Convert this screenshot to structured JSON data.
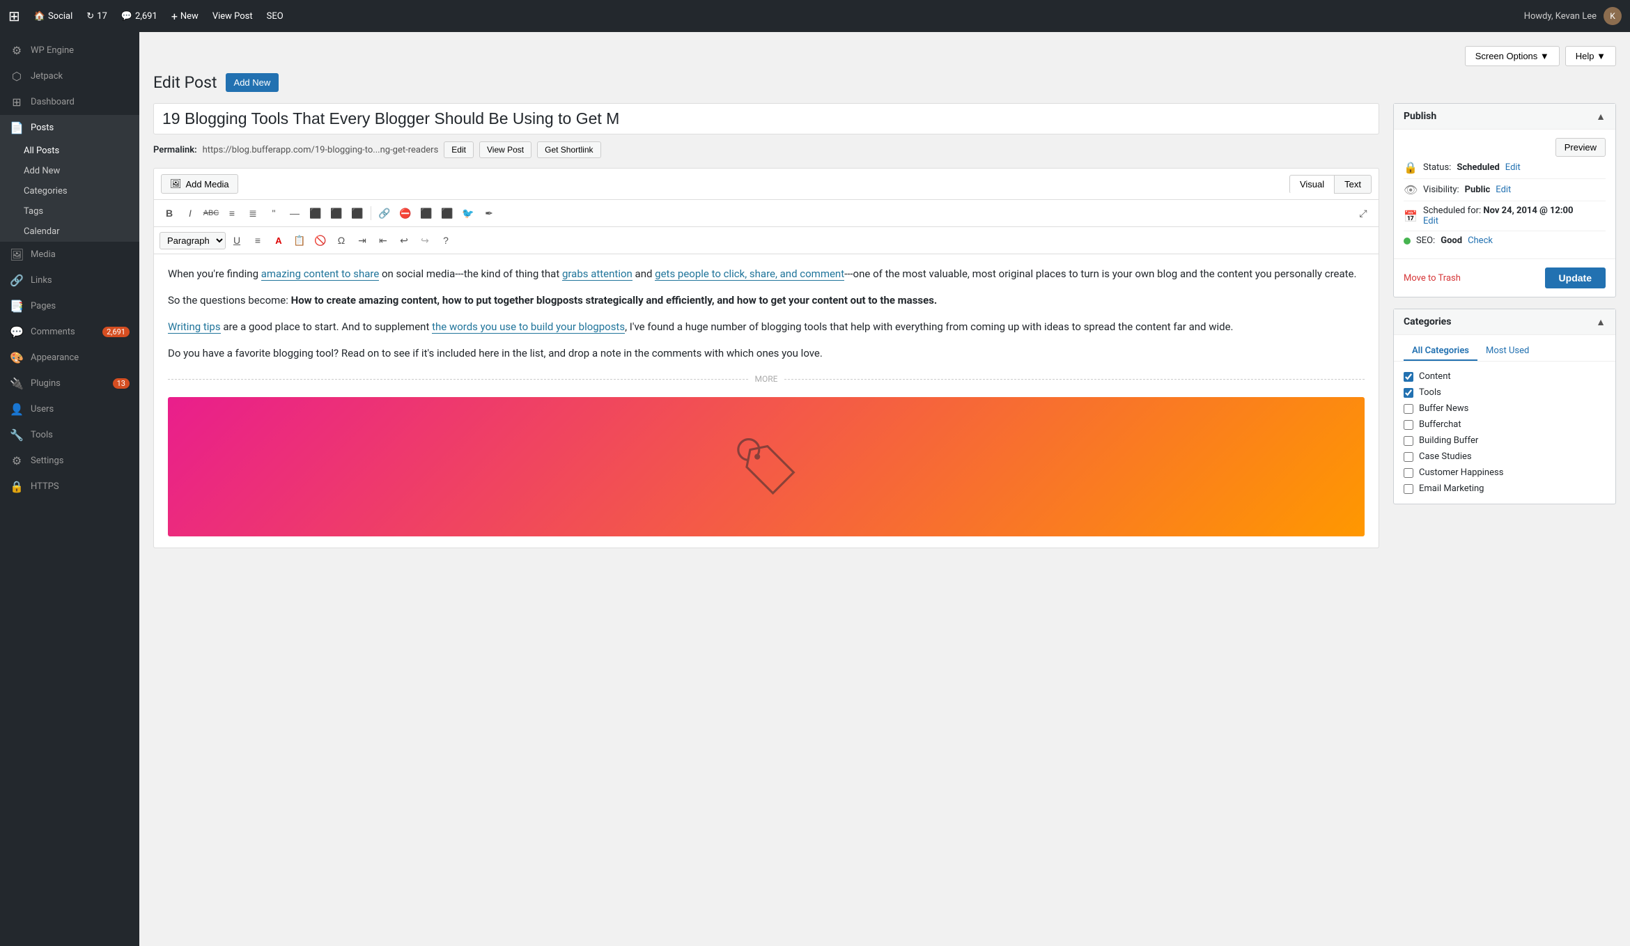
{
  "adminbar": {
    "logo": "W",
    "site_name": "Social",
    "updates_count": "17",
    "comments_count": "2,691",
    "new_label": "New",
    "view_post_label": "View Post",
    "seo_label": "SEO",
    "user_name": "Howdy, Kevan Lee"
  },
  "screen_options": {
    "screen_options_label": "Screen Options ▼",
    "help_label": "Help ▼"
  },
  "sidebar": {
    "wp_engine_label": "WP Engine",
    "jetpack_label": "Jetpack",
    "dashboard_label": "Dashboard",
    "posts_label": "Posts",
    "all_posts_label": "All Posts",
    "add_new_label": "Add New",
    "categories_label": "Categories",
    "tags_label": "Tags",
    "calendar_label": "Calendar",
    "media_label": "Media",
    "links_label": "Links",
    "pages_label": "Pages",
    "comments_label": "Comments",
    "comments_badge": "2,691",
    "appearance_label": "Appearance",
    "plugins_label": "Plugins",
    "plugins_badge": "13",
    "users_label": "Users",
    "tools_label": "Tools",
    "settings_label": "Settings",
    "https_label": "HTTPS"
  },
  "page": {
    "title": "Edit Post",
    "add_new_btn": "Add New"
  },
  "post": {
    "title": "19 Blogging Tools That Every Blogger Should Be Using to Get M",
    "permalink_label": "Permalink:",
    "permalink_url": "https://blog.bufferapp.com/19-blogging-to...ng-get-readers",
    "edit_btn": "Edit",
    "view_post_btn": "View Post",
    "get_shortlink_btn": "Get Shortlink"
  },
  "editor": {
    "add_media_label": "Add Media",
    "visual_tab": "Visual",
    "text_tab": "Text",
    "paragraph_select": "Paragraph",
    "content_html": "",
    "content_parts": [
      {
        "type": "paragraph",
        "text": "When you're finding ",
        "links": [
          {
            "text": "amazing content to share",
            "href": "#"
          },
          {
            "text": " on social media---the kind of thing that "
          },
          {
            "text": "grabs attention",
            "href": "#"
          },
          {
            "text": " and "
          },
          {
            "text": "gets people to click, share, and comment",
            "href": "#"
          },
          {
            "text": "---one of the most valuable, most original places to turn is your own blog and the content you personally create."
          }
        ]
      },
      {
        "type": "paragraph",
        "bold": true,
        "text": "So the questions become: How to create amazing content, how to put together blogposts strategically and efficiently, and how to get your content out to the masses."
      },
      {
        "type": "paragraph",
        "text": "Writing tips are a good place to start. And to supplement the words you use to build your blogposts, I've found a huge number of blogging tools that help with everything from coming up with ideas to spread the content far and wide."
      },
      {
        "type": "paragraph",
        "text": "Do you have a favorite blogging tool? Read on to see if it's included here in the list, and drop a note in the comments with which ones you love."
      }
    ],
    "more_label": "MORE"
  },
  "publish_panel": {
    "title": "Publish",
    "preview_btn": "Preview",
    "status_label": "Status:",
    "status_value": "Scheduled",
    "status_edit_link": "Edit",
    "visibility_label": "Visibility:",
    "visibility_value": "Public",
    "visibility_edit_link": "Edit",
    "scheduled_label": "Scheduled for:",
    "scheduled_value": "Nov 24, 2014 @ 12:00",
    "scheduled_edit_link": "Edit",
    "seo_label": "SEO:",
    "seo_value": "Good",
    "seo_check_link": "Check",
    "move_to_trash_label": "Move to Trash",
    "update_btn": "Update"
  },
  "categories_panel": {
    "title": "Categories",
    "all_categories_tab": "All Categories",
    "most_used_tab": "Most Used",
    "items": [
      {
        "label": "Content",
        "checked": true
      },
      {
        "label": "Tools",
        "checked": true
      },
      {
        "label": "Buffer News",
        "checked": false
      },
      {
        "label": "Bufferchat",
        "checked": false
      },
      {
        "label": "Building Buffer",
        "checked": false
      },
      {
        "label": "Case Studies",
        "checked": false
      },
      {
        "label": "Customer Happiness",
        "checked": false
      },
      {
        "label": "Email Marketing",
        "checked": false
      }
    ]
  },
  "toolbar_buttons": [
    {
      "icon": "B",
      "label": "bold",
      "style": "bold"
    },
    {
      "icon": "I",
      "label": "italic",
      "style": "italic"
    },
    {
      "icon": "ABC̶",
      "label": "strikethrough"
    },
    {
      "icon": "≡",
      "label": "unordered-list"
    },
    {
      "icon": "≣",
      "label": "ordered-list"
    },
    {
      "icon": "❝",
      "label": "blockquote"
    },
    {
      "icon": "—",
      "label": "horizontal-rule"
    },
    {
      "icon": "⬛",
      "label": "align-left"
    },
    {
      "icon": "⬛",
      "label": "align-center"
    },
    {
      "icon": "⬛",
      "label": "align-right"
    },
    {
      "icon": "🔗",
      "label": "link"
    },
    {
      "icon": "⊞",
      "label": "unlink"
    },
    {
      "icon": "⬛",
      "label": "insert-more"
    },
    {
      "icon": "⬛",
      "label": "insert-table"
    },
    {
      "icon": "🐦",
      "label": "twitter"
    },
    {
      "icon": "✒",
      "label": "pen"
    }
  ]
}
